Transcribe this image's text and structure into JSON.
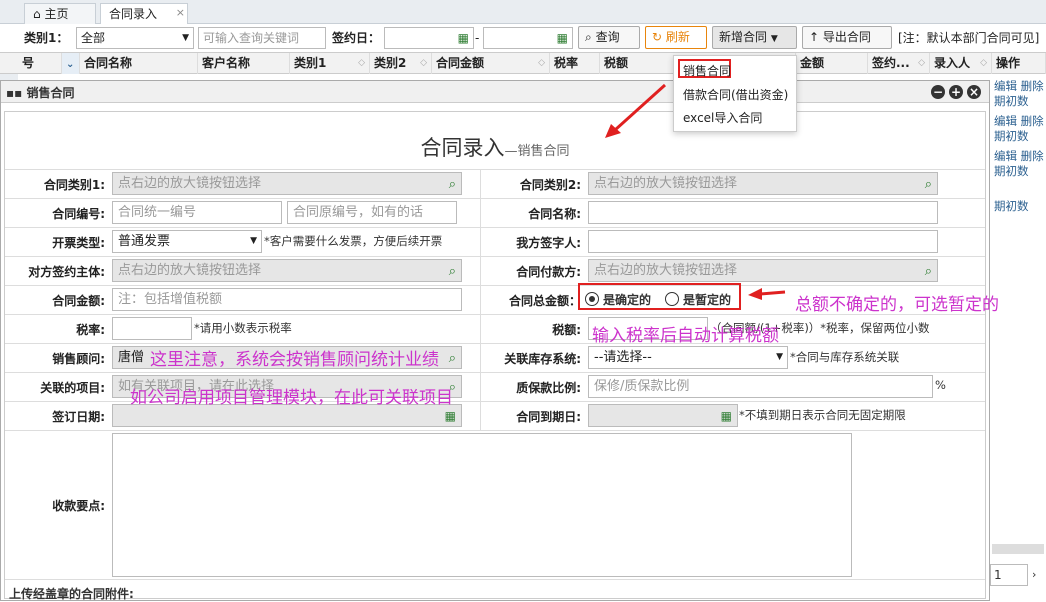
{
  "tabs": {
    "home": "主页",
    "entry": "合同录入"
  },
  "toolbar": {
    "cat1_label": "类别1：",
    "cat1_value": "全部",
    "search_placeholder": "可输入查询关键词",
    "sign_label": "签约日：",
    "date_dash": "-",
    "query": "查询",
    "refresh": "刷新",
    "new_contract": "新增合同",
    "export": "导出合同",
    "note": "[注：默认本部门合同可见]"
  },
  "grid": {
    "cols": [
      "号",
      "合同名称",
      "客户名称",
      "类别1",
      "类别2",
      "合同金额",
      "税率",
      "税额",
      "金额",
      "签约...",
      "录入人",
      "操作"
    ]
  },
  "dropdown": {
    "items": [
      "销售合同",
      "借款合同(借出资金)",
      "excel导入合同"
    ]
  },
  "rightcol": {
    "edit": "编辑",
    "delete": "删除",
    "initial": "期初数",
    "page": "1"
  },
  "panel": {
    "title": "销售合同"
  },
  "form": {
    "title": "合同录入",
    "subtitle": "—销售合同",
    "cat1_label": "合同类别1:",
    "cat1_ph": "点右边的放大镜按钮选择",
    "cat2_label": "合同类别2:",
    "cat2_ph": "点右边的放大镜按钮选择",
    "no_label": "合同编号:",
    "no_ph1": "合同统一编号",
    "no_ph2": "合同原编号，如有的话",
    "name_label": "合同名称:",
    "invoice_label": "开票类型:",
    "invoice_value": "普通发票",
    "invoice_hint": "*客户需要什么发票，方便后续开票",
    "signer_label": "我方签字人:",
    "party_label": "对方签约主体:",
    "party_ph": "点右边的放大镜按钮选择",
    "payer_label": "合同付款方:",
    "payer_ph": "点右边的放大镜按钮选择",
    "amount_label": "合同金额:",
    "amount_ph": "注：包括增值税额",
    "total_label": "合同总金额：",
    "radio1": "是确定的",
    "radio2": "是暂定的",
    "tax_rate_label": "税率:",
    "tax_rate_hint": "*请用小数表示税率",
    "tax_label": "税额:",
    "tax_hint": "（合同额/(1+税率)）*税率，保留两位小数",
    "consultant_label": "销售顾问:",
    "consultant_value": "唐僧",
    "inventory_label": "关联库存系统:",
    "inventory_value": "--请选择--",
    "inventory_hint": "*合同与库存系统关联",
    "project_label": "关联的项目:",
    "project_ph": "如有关联项目，请在此选择",
    "deposit_label": "质保款比例:",
    "deposit_ph": "保修/质保款比例",
    "deposit_unit": "%",
    "sign_date_label": "签订日期:",
    "end_date_label": "合同到期日:",
    "end_date_hint": "*不填到期日表示合同无固定期限",
    "payment_label": "收款要点:",
    "attach_label": "上传经盖章的合同附件:"
  },
  "annotations": {
    "a1": "总额不确定的，可选暂定的",
    "a2": "输入税率后自动计算税额",
    "a3": "这里注意，系统会按销售顾问统计业绩",
    "a4": "如公司启用项目管理模块，在此可关联项目"
  },
  "colors": {
    "annotation": "#cc33cc",
    "highlight": "#e02020",
    "accent": "#e8850c"
  }
}
